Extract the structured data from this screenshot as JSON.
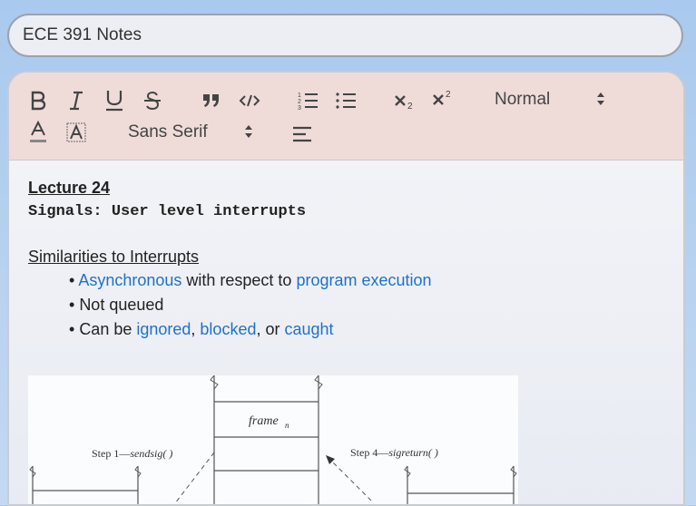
{
  "title": "ECE 391 Notes",
  "toolbar": {
    "header_select": "Normal",
    "font_select": "Sans Serif"
  },
  "content": {
    "lecture_title": "Lecture 24",
    "subtitle": "Signals: User level interrupts",
    "section_heading": "Similarities to Interrupts",
    "bullets": [
      {
        "parts": [
          {
            "text": "Asynchronous",
            "link": true
          },
          {
            "text": " with respect to ",
            "link": false
          },
          {
            "text": "program execution",
            "link": true
          }
        ]
      },
      {
        "parts": [
          {
            "text": "Not queued",
            "link": false
          }
        ]
      },
      {
        "parts": [
          {
            "text": "Can be ",
            "link": false
          },
          {
            "text": "ignored",
            "link": true
          },
          {
            "text": ", ",
            "link": false
          },
          {
            "text": "blocked",
            "link": true
          },
          {
            "text": ", or ",
            "link": false
          },
          {
            "text": "caught",
            "link": true
          }
        ]
      }
    ]
  },
  "figure": {
    "frame_label": "frame",
    "frame_sub": "n",
    "step1": "Step 1—",
    "step1_fn": "sendsig( )",
    "step4": "Step 4—",
    "step4_fn": "sigreturn( )"
  },
  "colors": {
    "link": "#1f72c7",
    "toolbar_bg": "#efdcd9",
    "icon": "#444444"
  }
}
